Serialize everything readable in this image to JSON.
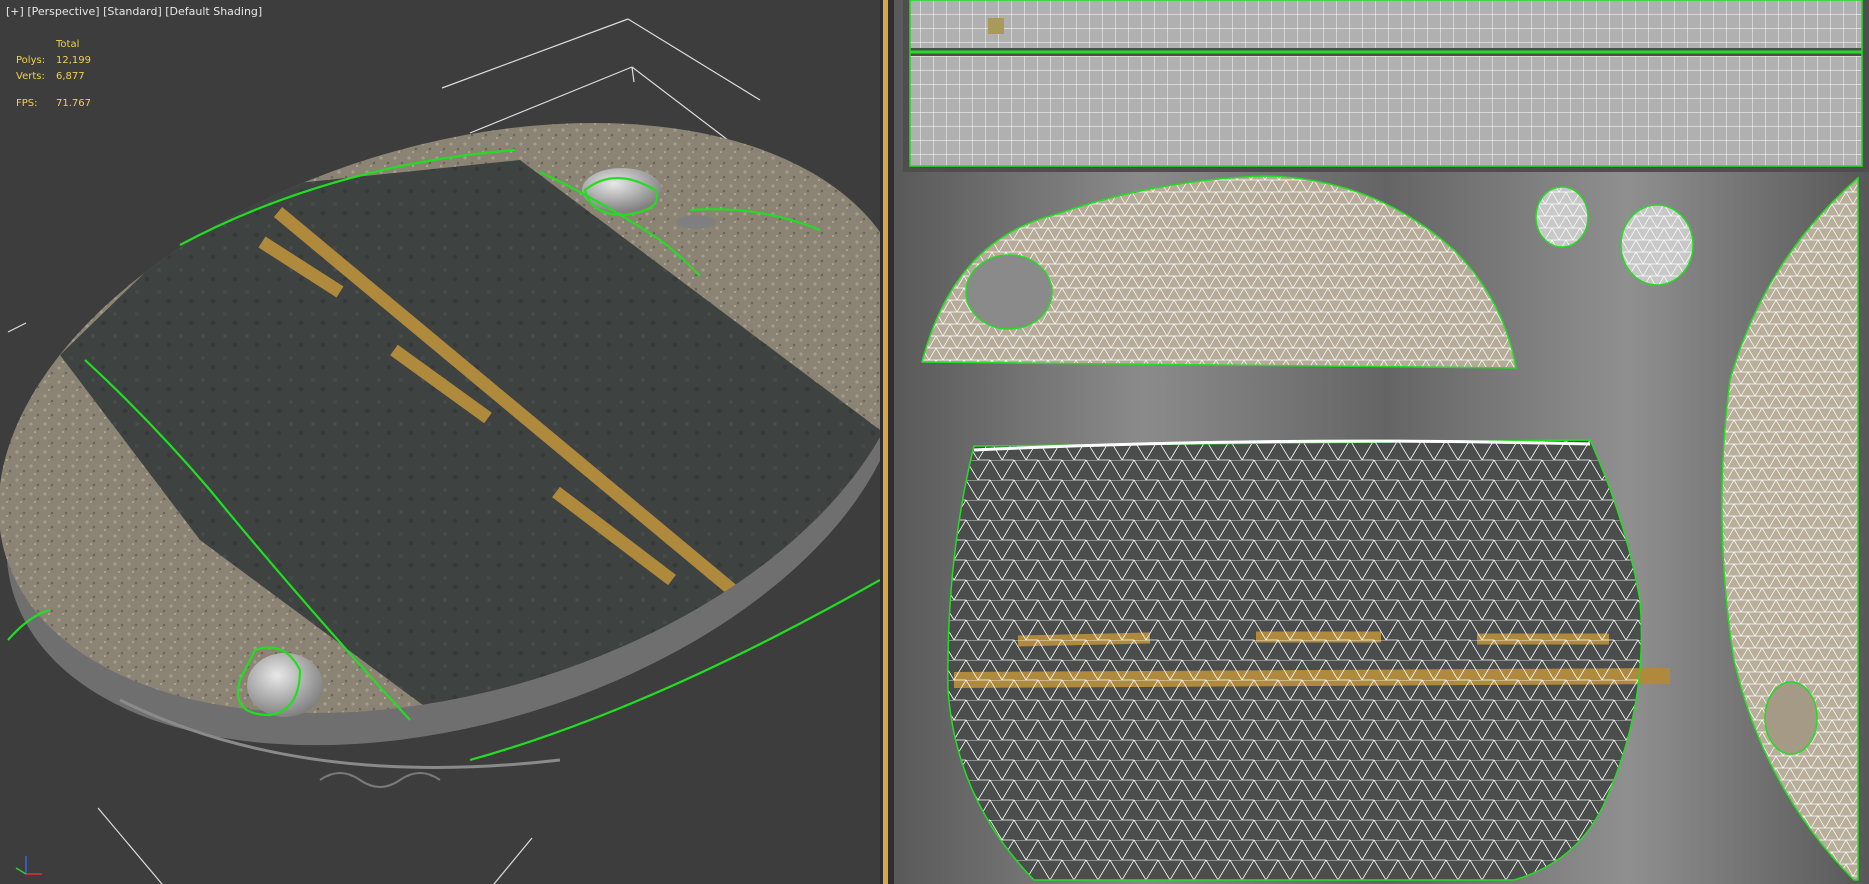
{
  "viewport": {
    "label": {
      "plus": "[+]",
      "view": "[Perspective]",
      "standard": "[Standard]",
      "shading": "[Default Shading]"
    },
    "stats": {
      "total_label": "Total",
      "polys_label": "Polys:",
      "polys_value": "12,199",
      "verts_label": "Verts:",
      "verts_value": "6,877",
      "fps_label": "FPS:",
      "fps_value": "71.767"
    }
  },
  "colors": {
    "stats_text": "#f0d050",
    "seam": "#22dd22",
    "splitter_accent": "#d8a648",
    "asphalt": "#3c403f",
    "road_line": "#b08a3c",
    "gravel": "#8a8272",
    "rim": "#9a9a9a"
  },
  "icons": {
    "axis_gizmo": "axis-gizmo-icon"
  }
}
